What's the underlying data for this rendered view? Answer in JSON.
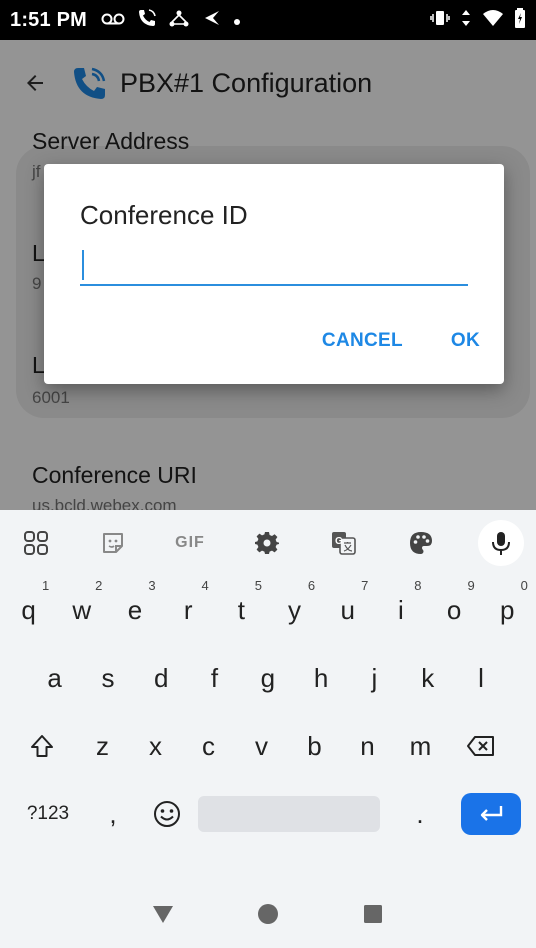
{
  "status_bar": {
    "time": "1:51 PM",
    "left_icons": [
      "voicemail-icon",
      "call-icon",
      "network-icon",
      "navigation-icon",
      "dot-icon"
    ],
    "right_icons": [
      "vibrate-icon",
      "data-icon",
      "wifi-icon",
      "battery-icon"
    ]
  },
  "app_bar": {
    "title": "PBX#1 Configuration",
    "back_icon": "arrow-back-icon",
    "title_icon": "phone-icon"
  },
  "background_fields": [
    {
      "label": "Server Address",
      "value": "jf"
    },
    {
      "label": "L",
      "value": "9"
    },
    {
      "label": "L",
      "value": "6001"
    },
    {
      "label": "Conference URI",
      "value": "us.bcld.webex.com"
    }
  ],
  "dialog": {
    "title": "Conference ID",
    "input_value": "",
    "cancel_label": "CANCEL",
    "ok_label": "OK"
  },
  "keyboard": {
    "toolbar": {
      "gif_label": "GIF",
      "icons": [
        "apps-grid-icon",
        "sticker-icon",
        "gif-icon",
        "settings-gear-icon",
        "translate-icon",
        "palette-icon",
        "microphone-icon"
      ]
    },
    "row1": [
      {
        "k": "q",
        "h": "1"
      },
      {
        "k": "w",
        "h": "2"
      },
      {
        "k": "e",
        "h": "3"
      },
      {
        "k": "r",
        "h": "4"
      },
      {
        "k": "t",
        "h": "5"
      },
      {
        "k": "y",
        "h": "6"
      },
      {
        "k": "u",
        "h": "7"
      },
      {
        "k": "i",
        "h": "8"
      },
      {
        "k": "o",
        "h": "9"
      },
      {
        "k": "p",
        "h": "0"
      }
    ],
    "row2": [
      "a",
      "s",
      "d",
      "f",
      "g",
      "h",
      "j",
      "k",
      "l"
    ],
    "row3": [
      "z",
      "x",
      "c",
      "v",
      "b",
      "n",
      "m"
    ],
    "row4": {
      "symbols_label": "?123",
      "comma": ",",
      "period": "."
    },
    "accent_color": "#1a73e8"
  },
  "nav_bar": {
    "icons": [
      "nav-back-triangle-icon",
      "nav-home-circle-icon",
      "nav-recents-square-icon"
    ]
  }
}
